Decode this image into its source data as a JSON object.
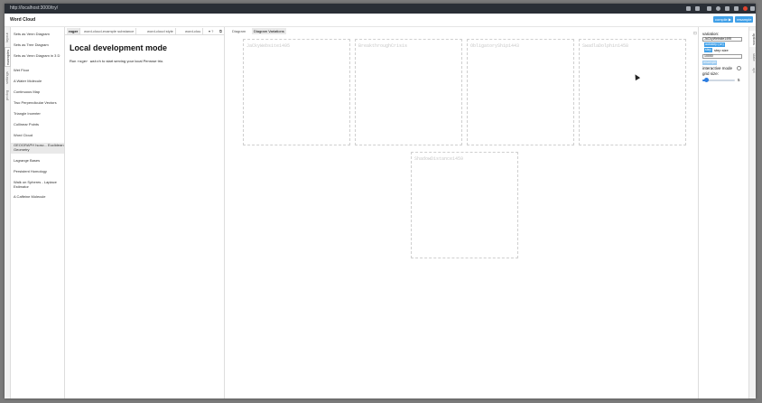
{
  "browser": {
    "url": "http://localhost:3000/try/"
  },
  "app": {
    "title": "Word Cloud",
    "compile_label": "compile ▶",
    "resample_label": "resample"
  },
  "left_tabs": [
    "layout",
    "examples",
    "settings",
    "prolog"
  ],
  "examples": [
    "Sets as Venn Diagram",
    "Sets as Tree Diagram",
    "Sets as Venn Diagram in 3 D",
    "Wet Floor",
    "A Water Molecule",
    "Continuous Map",
    "Two Perpendicular Vectors",
    "Triangle Incenter",
    "Collinear Points",
    "Word Cloud",
    "GEOGRAPH Isosc... Euclidean Geometry",
    "Lagrange Bases",
    "Persistent Homology",
    "Walk on Spheres - Laplace Estimator",
    "A Caffeine Molecule"
  ],
  "editor_tabs": [
    "roger",
    "word-cloud-example substance",
    "word-cloud style",
    "word-clou"
  ],
  "local": {
    "heading": "Local development mode",
    "desc_prefix": "Run",
    "desc_code": "roger watch",
    "desc_suffix": "to start serving your local Penrose trio."
  },
  "panel_tabs": [
    "Diagram",
    "Diagram Variations"
  ],
  "variations": [
    "JaCkyWebsite1495",
    "BreakthroughCrisis",
    "ObligatoryShip1443",
    "SwadlaDolphin1458",
    "ShadowDistance1459"
  ],
  "right": {
    "variation_label": "variation:",
    "variation_value": "JaCkyWebsite1495",
    "autostep_label": "autostep (on)",
    "step_label": "step",
    "step_size_label": "step size",
    "step_size_value": "10000",
    "resample_label": "resample",
    "interactive_label": "interactive mode",
    "grid_label": "grid size:",
    "grid_value": "5",
    "grid_fraction": 0.1
  },
  "right_tabs": [
    "options",
    "state",
    "opt"
  ]
}
